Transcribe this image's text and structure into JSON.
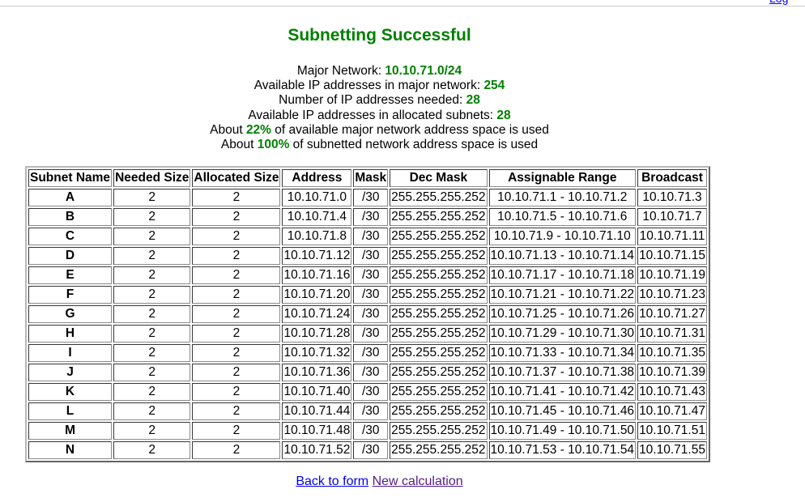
{
  "title": "Subnetting Successful",
  "summary": {
    "major_network_label": "Major Network: ",
    "major_network": "10.10.71.0/24",
    "available_major_label": "Available IP addresses in major network: ",
    "available_major": "254",
    "needed_label": "Number of IP addresses needed: ",
    "needed": "28",
    "available_alloc_label": "Available IP addresses in allocated subnets: ",
    "available_alloc": "28",
    "major_used_prefix": "About ",
    "major_used_pct": "22%",
    "major_used_suffix": " of available major network address space is used",
    "sub_used_prefix": "About ",
    "sub_used_pct": "100%",
    "sub_used_suffix": " of subnetted network address space is used"
  },
  "table": {
    "headers": [
      "Subnet Name",
      "Needed Size",
      "Allocated Size",
      "Address",
      "Mask",
      "Dec Mask",
      "Assignable Range",
      "Broadcast"
    ],
    "rows": [
      [
        "A",
        "2",
        "2",
        "10.10.71.0",
        "/30",
        "255.255.255.252",
        "10.10.71.1 - 10.10.71.2",
        "10.10.71.3"
      ],
      [
        "B",
        "2",
        "2",
        "10.10.71.4",
        "/30",
        "255.255.255.252",
        "10.10.71.5 - 10.10.71.6",
        "10.10.71.7"
      ],
      [
        "C",
        "2",
        "2",
        "10.10.71.8",
        "/30",
        "255.255.255.252",
        "10.10.71.9 - 10.10.71.10",
        "10.10.71.11"
      ],
      [
        "D",
        "2",
        "2",
        "10.10.71.12",
        "/30",
        "255.255.255.252",
        "10.10.71.13 - 10.10.71.14",
        "10.10.71.15"
      ],
      [
        "E",
        "2",
        "2",
        "10.10.71.16",
        "/30",
        "255.255.255.252",
        "10.10.71.17 - 10.10.71.18",
        "10.10.71.19"
      ],
      [
        "F",
        "2",
        "2",
        "10.10.71.20",
        "/30",
        "255.255.255.252",
        "10.10.71.21 - 10.10.71.22",
        "10.10.71.23"
      ],
      [
        "G",
        "2",
        "2",
        "10.10.71.24",
        "/30",
        "255.255.255.252",
        "10.10.71.25 - 10.10.71.26",
        "10.10.71.27"
      ],
      [
        "H",
        "2",
        "2",
        "10.10.71.28",
        "/30",
        "255.255.255.252",
        "10.10.71.29 - 10.10.71.30",
        "10.10.71.31"
      ],
      [
        "I",
        "2",
        "2",
        "10.10.71.32",
        "/30",
        "255.255.255.252",
        "10.10.71.33 - 10.10.71.34",
        "10.10.71.35"
      ],
      [
        "J",
        "2",
        "2",
        "10.10.71.36",
        "/30",
        "255.255.255.252",
        "10.10.71.37 - 10.10.71.38",
        "10.10.71.39"
      ],
      [
        "K",
        "2",
        "2",
        "10.10.71.40",
        "/30",
        "255.255.255.252",
        "10.10.71.41 - 10.10.71.42",
        "10.10.71.43"
      ],
      [
        "L",
        "2",
        "2",
        "10.10.71.44",
        "/30",
        "255.255.255.252",
        "10.10.71.45 - 10.10.71.46",
        "10.10.71.47"
      ],
      [
        "M",
        "2",
        "2",
        "10.10.71.48",
        "/30",
        "255.255.255.252",
        "10.10.71.49 - 10.10.71.50",
        "10.10.71.51"
      ],
      [
        "N",
        "2",
        "2",
        "10.10.71.52",
        "/30",
        "255.255.255.252",
        "10.10.71.53 - 10.10.71.54",
        "10.10.71.55"
      ]
    ]
  },
  "footer": {
    "back_label": "Back to form",
    "new_label": "New calculation"
  }
}
